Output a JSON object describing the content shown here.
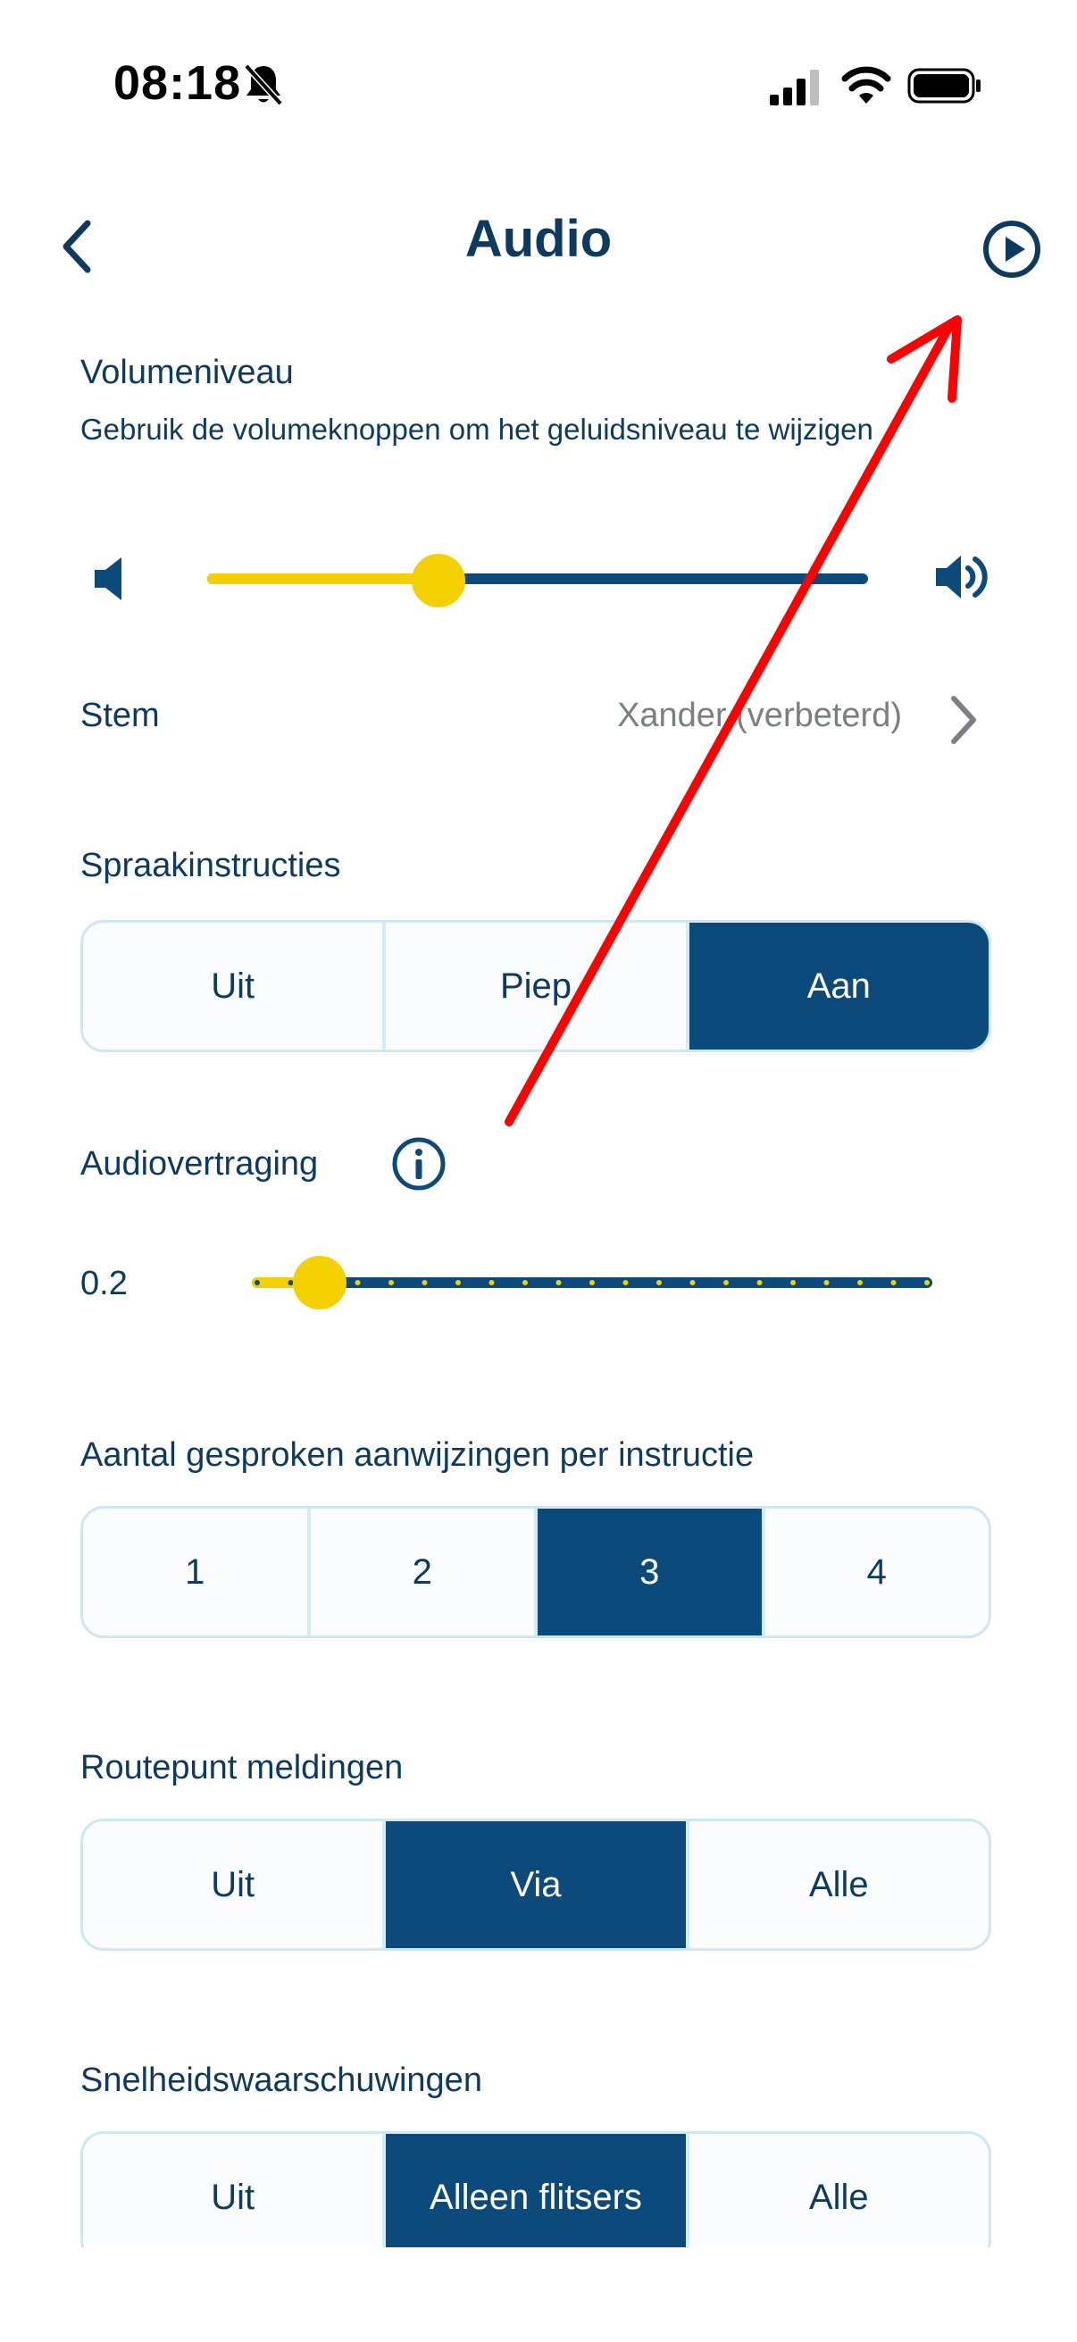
{
  "status_bar": {
    "time": "08:18"
  },
  "nav": {
    "title": "Audio"
  },
  "volume": {
    "label": "Volumeniveau",
    "description": "Gebruik de volumeknoppen om het geluidsniveau te wijzigen",
    "level": 0.35
  },
  "stem": {
    "label": "Stem",
    "value": "Xander (verbeterd)"
  },
  "spraakinstructies": {
    "label": "Spraakinstructies",
    "options": [
      "Uit",
      "Piep",
      "Aan"
    ],
    "selected": "Aan"
  },
  "audiovertraging": {
    "label": "Audiovertraging",
    "value": "0.2",
    "level": 0.1,
    "steps": 21
  },
  "aanwijzingen": {
    "label": "Aantal gesproken aanwijzingen per instructie",
    "options": [
      "1",
      "2",
      "3",
      "4"
    ],
    "selected": "3"
  },
  "routepunt": {
    "label": "Routepunt meldingen",
    "options": [
      "Uit",
      "Via",
      "Alle"
    ],
    "selected": "Via"
  },
  "snelheid": {
    "label": "Snelheidswaarschuwingen",
    "options": [
      "Uit",
      "Alleen flitsers",
      "Alle"
    ],
    "selected": "Alleen flitsers"
  },
  "colors": {
    "accent": "#0d4a7c",
    "slider_fill": "#f5d000",
    "annotation": "#ff0000",
    "segment_border": "#cfe6f6"
  },
  "icons": {
    "back": "chevron-left-icon",
    "play": "play-circle-icon",
    "bell": "bell-slash-icon",
    "volume_low": "speaker-low-icon",
    "volume_high": "speaker-high-icon",
    "info": "info-circle-icon",
    "stem_chevron": "chevron-right-icon"
  }
}
